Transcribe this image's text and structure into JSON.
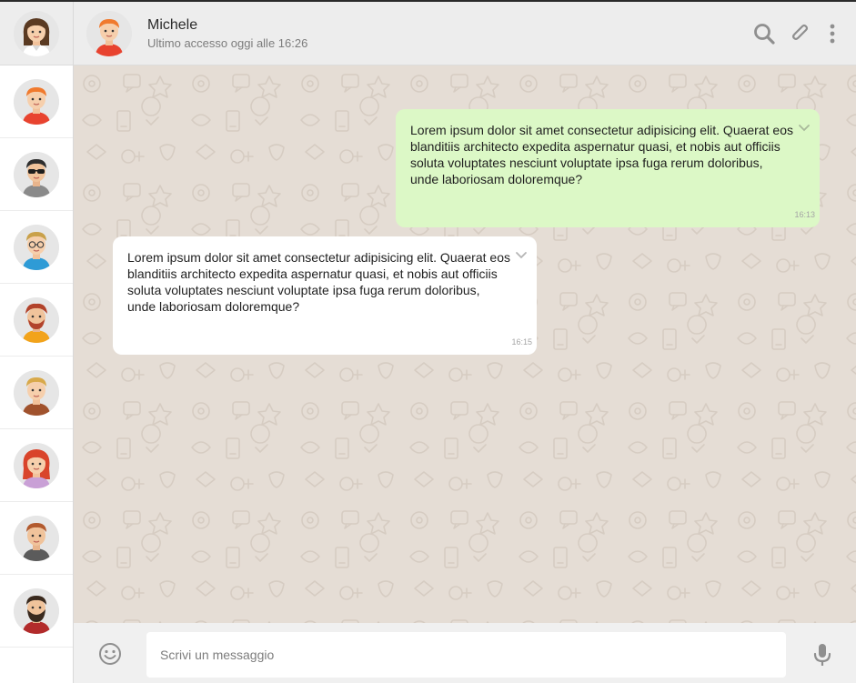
{
  "app": {
    "accent_sent_bubble": "#dcf8c6",
    "chat_background": "#e5ddd5",
    "header_background": "#ededed"
  },
  "sidebar": {
    "profile": {
      "avatar": "user-avatar-woman-brown-hair"
    },
    "contacts": [
      {
        "avatar": "contact-avatar-red-hair"
      },
      {
        "avatar": "contact-avatar-sunglasses"
      },
      {
        "avatar": "contact-avatar-glasses"
      },
      {
        "avatar": "contact-avatar-beard"
      },
      {
        "avatar": "contact-avatar-blond"
      },
      {
        "avatar": "contact-avatar-red-hair-woman"
      },
      {
        "avatar": "contact-avatar-brown-hair"
      },
      {
        "avatar": "contact-avatar-full-beard"
      }
    ]
  },
  "header": {
    "name": "Michele",
    "status": "Ultimo accesso oggi alle 16:26",
    "icons": [
      "search-icon",
      "attach-icon",
      "more-vert-icon"
    ]
  },
  "messages": [
    {
      "type": "sent",
      "text": "Lorem ipsum dolor sit amet consectetur adipisicing elit. Quaerat eos blanditiis architecto expedita aspernatur quasi, et nobis aut officiis soluta voluptates nesciunt voluptate ipsa fuga rerum doloribus, unde laboriosam doloremque?",
      "time": "16:13"
    },
    {
      "type": "received",
      "text": "Lorem ipsum dolor sit amet consectetur adipisicing elit. Quaerat eos blanditiis architecto expedita aspernatur quasi, et nobis aut officiis soluta voluptates nesciunt voluptate ipsa fuga rerum doloribus, unde laboriosam doloremque?",
      "time": "16:15"
    }
  ],
  "composer": {
    "placeholder": "Scrivi un messaggio",
    "value": "",
    "icons": [
      "emoji-icon",
      "microphone-icon"
    ]
  }
}
